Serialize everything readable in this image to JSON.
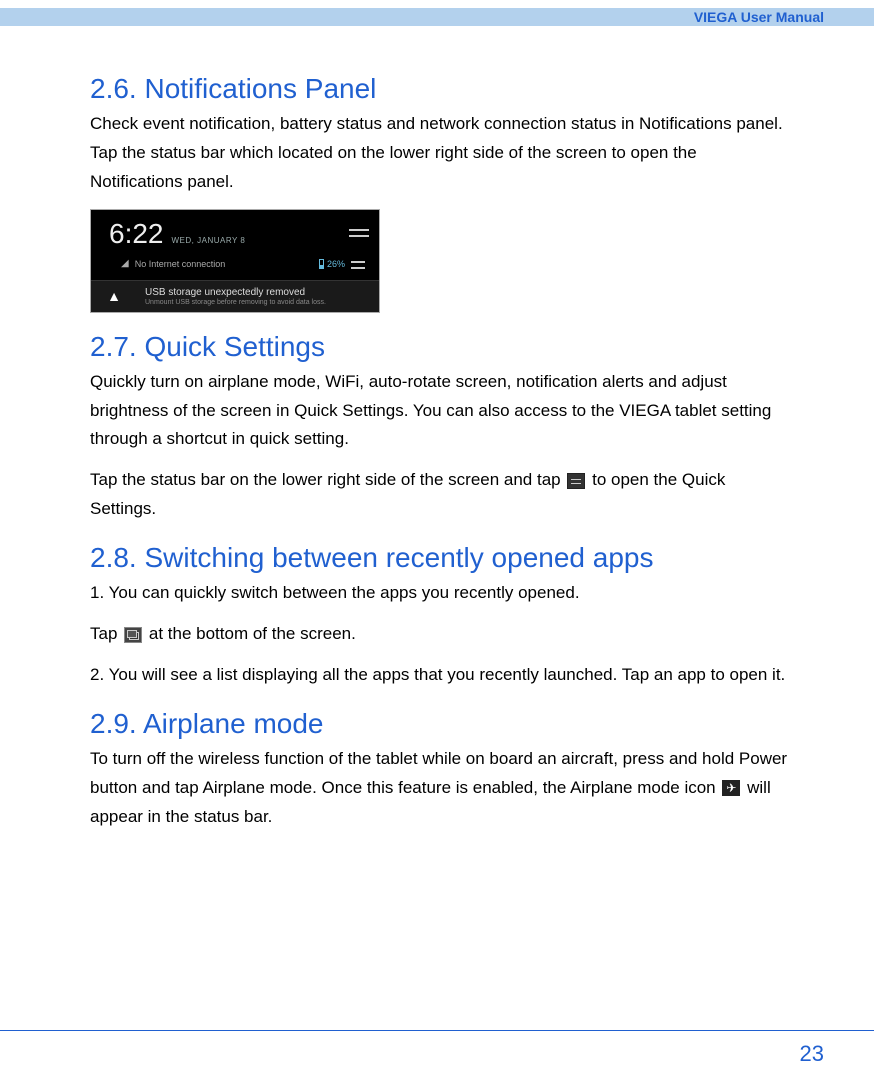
{
  "header": {
    "title": "VIEGA User Manual"
  },
  "sections": {
    "s1": {
      "heading": "2.6. Notifications Panel",
      "p1": "Check event notification, battery status and network connection status in Notifications panel. Tap the status bar which located on the lower right side of the screen to open the Notifications panel."
    },
    "screenshot": {
      "time": "6:22",
      "date": "WED, JANUARY 8",
      "no_internet": "No Internet connection",
      "battery": "26%",
      "notif_title": "USB storage unexpectedly removed",
      "notif_sub": "Unmount USB storage before removing to avoid data loss."
    },
    "s2": {
      "heading": "2.7. Quick Settings",
      "p1": "Quickly turn on airplane mode, WiFi, auto-rotate screen, notification alerts and adjust brightness of the screen in Quick Settings. You can also access to the VIEGA tablet setting through a shortcut in quick setting.",
      "p2a": "Tap the status bar on the lower right side of the screen and tap ",
      "p2b": " to open the Quick Settings."
    },
    "s3": {
      "heading": "2.8. Switching between recently opened apps",
      "p1": "1. You can quickly switch between the apps you recently opened.",
      "p2a": "Tap ",
      "p2b": " at the bottom of the screen.",
      "p3": "2. You will see a list displaying all the apps that you recently launched. Tap an app to open it."
    },
    "s4": {
      "heading": "2.9. Airplane mode",
      "p1a": "To turn off the wireless function of the tablet while on board an aircraft, press and hold Power button and tap Airplane mode. Once this feature is enabled, the Airplane mode icon ",
      "p1b": " will appear in the status bar."
    }
  },
  "footer": {
    "page": "23"
  }
}
